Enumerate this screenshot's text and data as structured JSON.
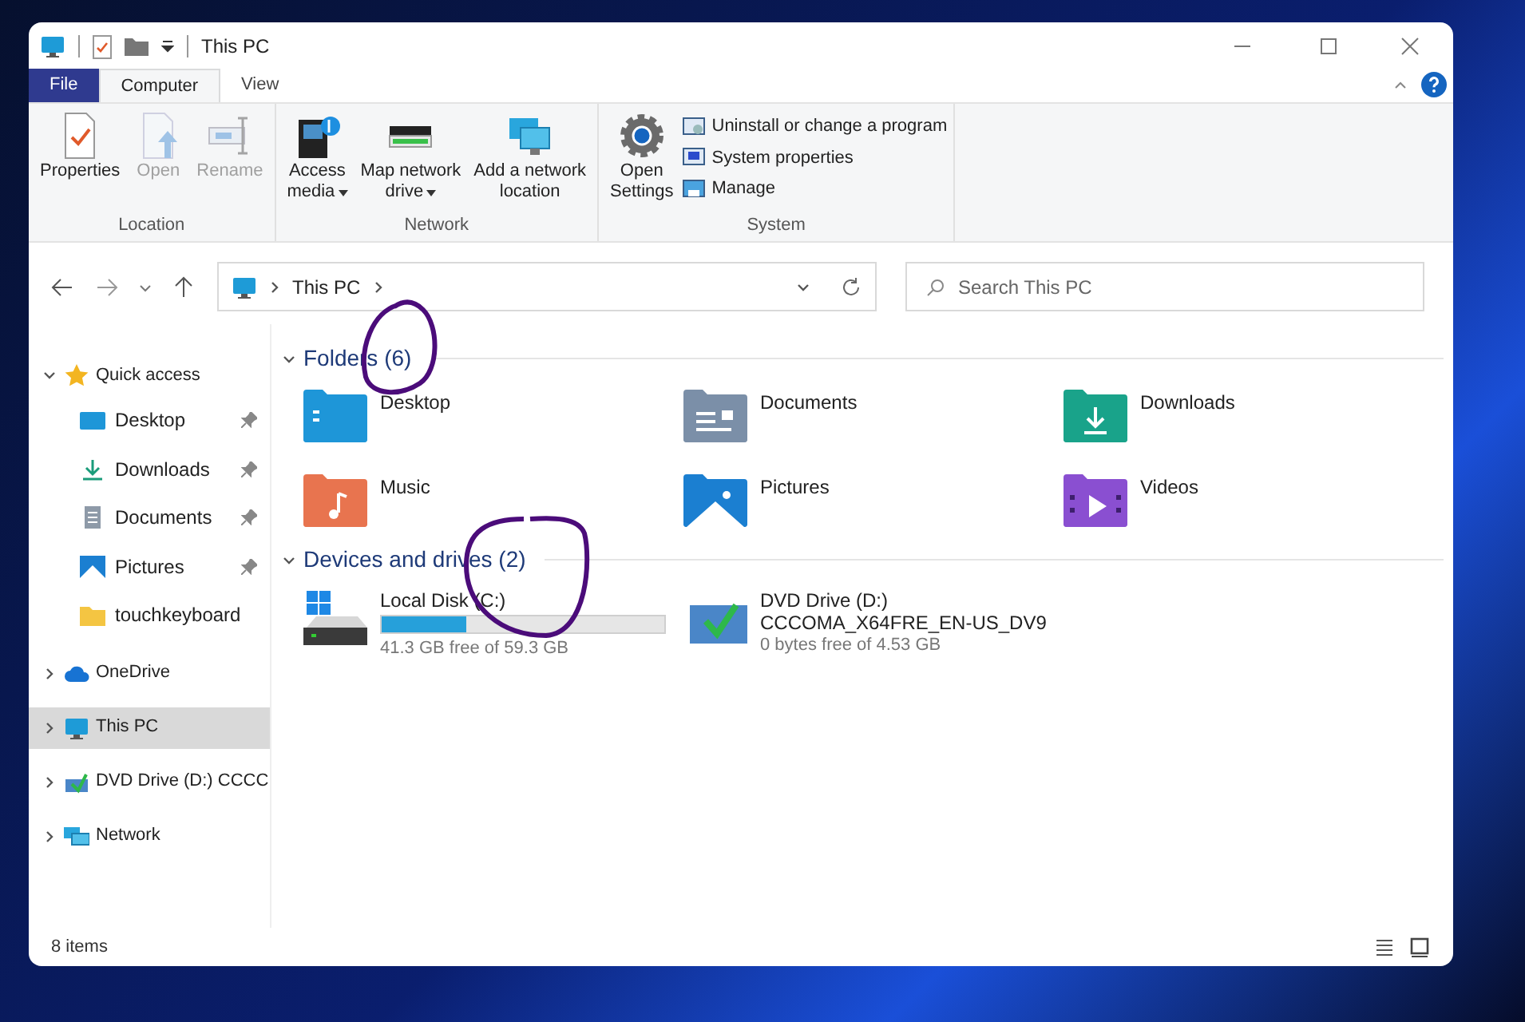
{
  "window": {
    "title": "This PC"
  },
  "ribbon_tabs": [
    {
      "label": "File",
      "kind": "file",
      "selected": false
    },
    {
      "label": "Computer",
      "kind": "tab",
      "selected": true
    },
    {
      "label": "View",
      "kind": "tab",
      "selected": false
    }
  ],
  "ribbon_groups": [
    {
      "name": "Location",
      "buttons": [
        {
          "kind": "large",
          "lines": [
            "Properties"
          ],
          "disabled": false,
          "dropdown": false
        },
        {
          "kind": "large",
          "lines": [
            "Open"
          ],
          "disabled": true,
          "dropdown": false
        },
        {
          "kind": "large",
          "lines": [
            "Rename"
          ],
          "disabled": true,
          "dropdown": false
        }
      ]
    },
    {
      "name": "Network",
      "buttons": [
        {
          "kind": "large",
          "lines": [
            "Access",
            "media"
          ],
          "disabled": false,
          "dropdown": true
        },
        {
          "kind": "large",
          "lines": [
            "Map network",
            "drive"
          ],
          "disabled": false,
          "dropdown": true
        },
        {
          "kind": "large",
          "lines": [
            "Add a network",
            "location"
          ],
          "disabled": false,
          "dropdown": false
        }
      ]
    },
    {
      "name": "System",
      "buttons": [
        {
          "kind": "large",
          "lines": [
            "Open",
            "Settings"
          ],
          "disabled": false,
          "dropdown": false
        },
        {
          "kind": "small",
          "lines": [
            "Uninstall or change a program"
          ],
          "disabled": false,
          "dropdown": false
        },
        {
          "kind": "small",
          "lines": [
            "System properties"
          ],
          "disabled": false,
          "dropdown": false
        },
        {
          "kind": "small",
          "lines": [
            "Manage"
          ],
          "disabled": false,
          "dropdown": false
        }
      ]
    }
  ],
  "address_bar": {
    "path": [
      "This PC"
    ]
  },
  "search": {
    "placeholder": "Search This PC"
  },
  "sidebar": {
    "items": [
      {
        "label": "Quick access",
        "expanded": true,
        "selected": false,
        "children": [
          {
            "label": "Desktop",
            "pinned": true
          },
          {
            "label": "Downloads",
            "pinned": true
          },
          {
            "label": "Documents",
            "pinned": true
          },
          {
            "label": "Pictures",
            "pinned": true
          },
          {
            "label": "touchkeyboard",
            "pinned": false
          }
        ]
      },
      {
        "label": "OneDrive",
        "expanded": false,
        "selected": false
      },
      {
        "label": "This PC",
        "expanded": false,
        "selected": true
      },
      {
        "label": "DVD Drive (D:) CCCC",
        "expanded": false,
        "selected": false
      },
      {
        "label": "Network",
        "expanded": false,
        "selected": false
      }
    ]
  },
  "sections": [
    {
      "kind": "folders",
      "title": "Folders (6)",
      "expanded": true,
      "items": [
        {
          "name": "Desktop"
        },
        {
          "name": "Documents"
        },
        {
          "name": "Downloads"
        },
        {
          "name": "Music"
        },
        {
          "name": "Pictures"
        },
        {
          "name": "Videos"
        }
      ]
    },
    {
      "kind": "drives",
      "title": "Devices and drives (2)",
      "expanded": true,
      "items": [
        {
          "kind": "disk",
          "name": "Local Disk (C:)",
          "level": 0.3,
          "info": "41.3 GB free of 59.3 GB"
        },
        {
          "kind": "dvd",
          "name": "DVD Drive (D:)",
          "subtitle": "CCCOMA_X64FRE_EN-US_DV9",
          "info": "0 bytes free of 4.53 GB"
        }
      ]
    }
  ],
  "status_bar": {
    "text": "8 items"
  }
}
